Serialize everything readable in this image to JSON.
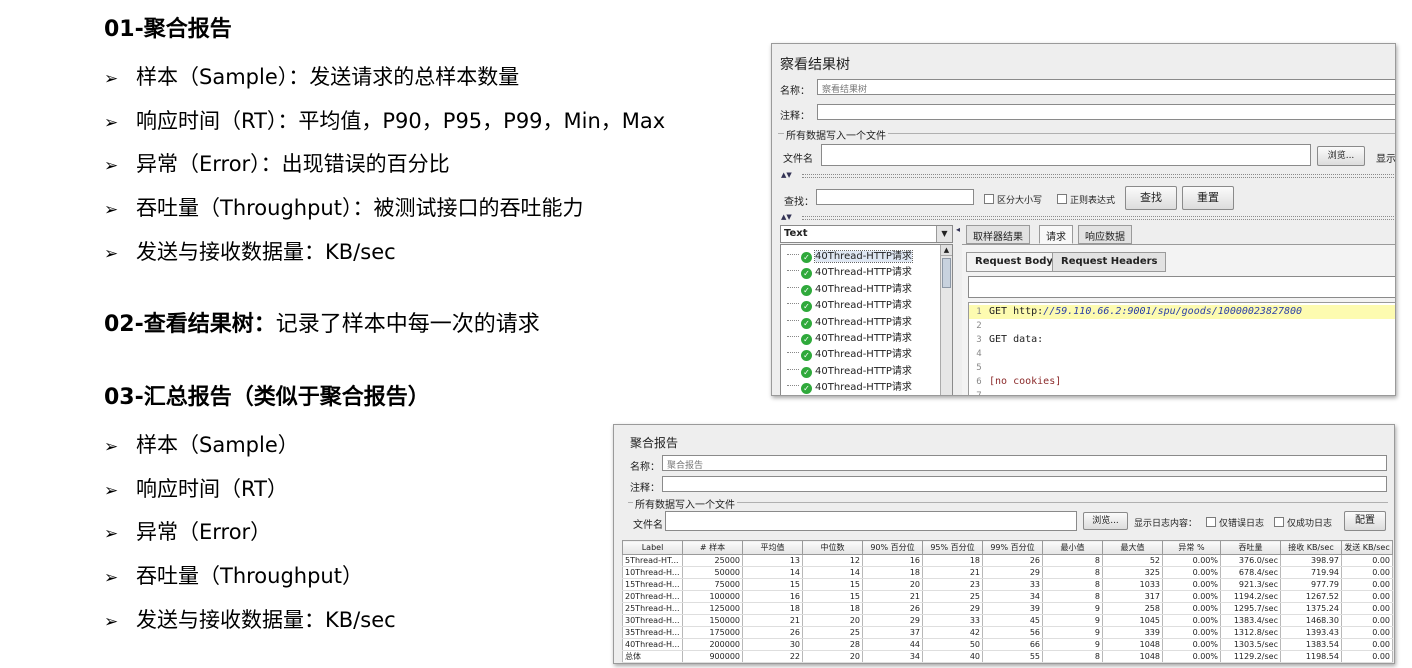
{
  "slide": {
    "sec1": {
      "title": "01-聚合报告",
      "bullets": [
        "样本（Sample）：发送请求的总样本数量",
        "响应时间（RT）：平均值，P90，P95，P99，Min，Max",
        "异常（Error）：出现错误的百分比",
        "吞吐量（Throughput）：被测试接口的吞吐能力",
        "发送与接收数据量：KB/sec"
      ]
    },
    "sec2": {
      "title": "02-查看结果树：",
      "rest": "记录了样本中每一次的请求"
    },
    "sec3": {
      "title": "03-汇总报告（类似于聚合报告）",
      "bullets": [
        "样本（Sample）",
        "响应时间（RT）",
        "异常（Error）",
        "吞吐量（Throughput）",
        "发送与接收数据量：KB/sec"
      ]
    },
    "bullet_marker": "➢"
  },
  "result_tree": {
    "title": "察看结果树",
    "name_label": "名称：",
    "name_value": "察看结果树",
    "comment_label": "注释：",
    "file_group": "所有数据写入一个文件",
    "file_label": "文件名",
    "browse": "浏览...",
    "display_cut": "显示",
    "search_label": "查找：",
    "case_sensitive": "区分大小写",
    "regex": "正则表达式",
    "find": "查找",
    "reset": "重置",
    "renderer": "Text",
    "tree_items": [
      "40Thread-HTTP请求",
      "40Thread-HTTP请求",
      "40Thread-HTTP请求",
      "40Thread-HTTP请求",
      "40Thread-HTTP请求",
      "40Thread-HTTP请求",
      "40Thread-HTTP请求",
      "40Thread-HTTP请求",
      "40Thread-HTTP请求"
    ],
    "tabs": [
      "取样器结果",
      "请求",
      "响应数据"
    ],
    "subtabs": [
      "Request Body",
      "Request Headers"
    ],
    "code_lines": [
      {
        "n": "1",
        "pre": "GET http:",
        "url": "//59.110.66.2:9001/spu/goods/10000023827800"
      },
      {
        "n": "2",
        "pre": "",
        "url": ""
      },
      {
        "n": "3",
        "pre": "GET data:",
        "url": ""
      },
      {
        "n": "4",
        "pre": "",
        "url": ""
      },
      {
        "n": "5",
        "pre": "",
        "url": ""
      },
      {
        "n": "6",
        "pre": "[no cookies]",
        "url": ""
      },
      {
        "n": "7",
        "pre": "",
        "url": ""
      }
    ],
    "icon": "check-circle-icon"
  },
  "aggregate": {
    "title": "聚合报告",
    "name_label": "名称：",
    "name_value": "聚合报告",
    "comment_label": "注释：",
    "file_group": "所有数据写入一个文件",
    "file_label": "文件名",
    "browse": "浏览...",
    "log_label": "显示日志内容：",
    "errors_only": "仅错误日志",
    "success_only": "仅成功日志",
    "configure": "配置",
    "headers": [
      "Label",
      "# 样本",
      "平均值",
      "中位数",
      "90% 百分位",
      "95% 百分位",
      "99% 百分位",
      "最小值",
      "最大值",
      "异常 %",
      "吞吐量",
      "接收 KB/sec",
      "发送 KB/sec"
    ],
    "rows": [
      [
        "5Thread-HT...",
        "25000",
        "13",
        "12",
        "16",
        "18",
        "26",
        "8",
        "52",
        "0.00%",
        "376.0/sec",
        "398.97",
        "0.00"
      ],
      [
        "10Thread-H...",
        "50000",
        "14",
        "14",
        "18",
        "21",
        "29",
        "8",
        "325",
        "0.00%",
        "678.4/sec",
        "719.94",
        "0.00"
      ],
      [
        "15Thread-H...",
        "75000",
        "15",
        "15",
        "20",
        "23",
        "33",
        "8",
        "1033",
        "0.00%",
        "921.3/sec",
        "977.79",
        "0.00"
      ],
      [
        "20Thread-H...",
        "100000",
        "16",
        "15",
        "21",
        "25",
        "34",
        "8",
        "317",
        "0.00%",
        "1194.2/sec",
        "1267.52",
        "0.00"
      ],
      [
        "25Thread-H...",
        "125000",
        "18",
        "18",
        "26",
        "29",
        "39",
        "9",
        "258",
        "0.00%",
        "1295.7/sec",
        "1375.24",
        "0.00"
      ],
      [
        "30Thread-H...",
        "150000",
        "21",
        "20",
        "29",
        "33",
        "45",
        "9",
        "1045",
        "0.00%",
        "1383.4/sec",
        "1468.30",
        "0.00"
      ],
      [
        "35Thread-H...",
        "175000",
        "26",
        "25",
        "37",
        "42",
        "56",
        "9",
        "339",
        "0.00%",
        "1312.8/sec",
        "1393.43",
        "0.00"
      ],
      [
        "40Thread-H...",
        "200000",
        "30",
        "28",
        "44",
        "50",
        "66",
        "9",
        "1048",
        "0.00%",
        "1303.5/sec",
        "1383.54",
        "0.00"
      ],
      [
        "总体",
        "900000",
        "22",
        "20",
        "34",
        "40",
        "55",
        "8",
        "1048",
        "0.00%",
        "1129.2/sec",
        "1198.54",
        "0.00"
      ]
    ]
  }
}
